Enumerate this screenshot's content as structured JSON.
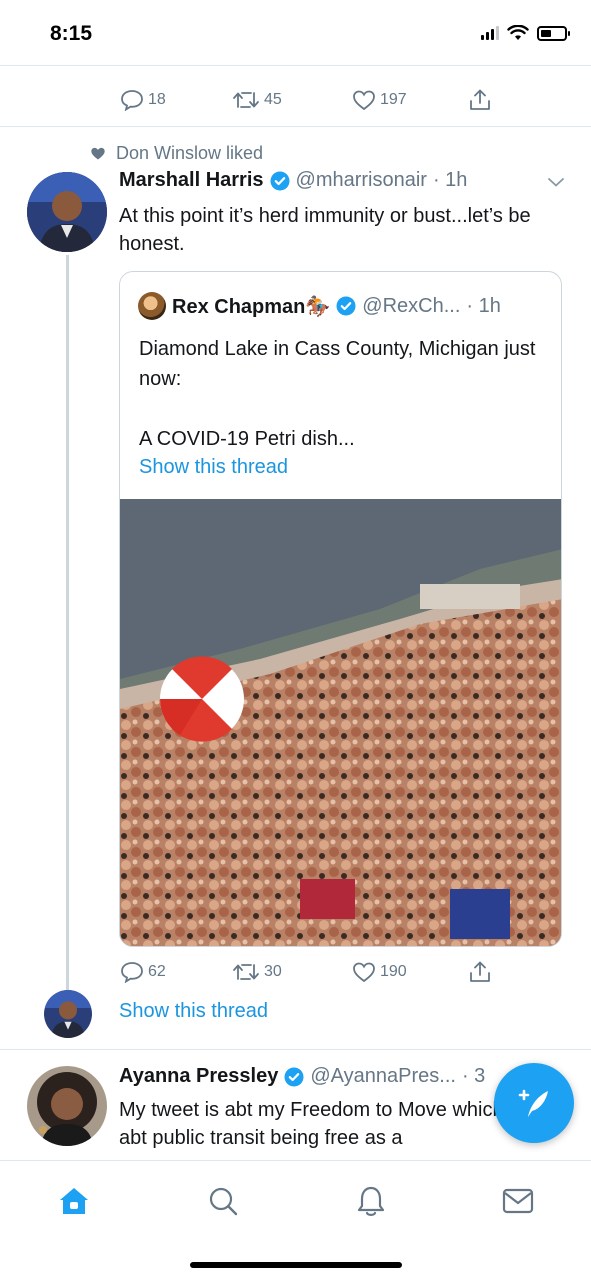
{
  "status_bar": {
    "time": "8:15",
    "battery_level": 0.45
  },
  "prev_tweet_actions": {
    "replies": "18",
    "retweets": "45",
    "likes": "197"
  },
  "tweet": {
    "liked_by": "Don Winslow liked",
    "author_name": "Marshall Harris",
    "handle": "@mharrisonair",
    "time": "· 1h",
    "text": "At this point it’s herd immunity or bust...let’s be honest.",
    "quote": {
      "author_name": "Rex Chapman🏇🏼",
      "handle": "@RexCh...",
      "time": "· 1h",
      "text": "Diamond Lake in Cass County, Michigan just now:\n\nA COVID-19 Petri dish...",
      "show_thread": "Show this thread"
    },
    "actions": {
      "replies": "62",
      "retweets": "30",
      "likes": "190"
    },
    "show_thread": "Show this thread"
  },
  "next_tweet": {
    "author_name": "Ayanna Pressley",
    "handle": "@AyannaPres...",
    "time": "· 3",
    "text": "My tweet is abt my Freedom to Move which is abt public transit being free as a"
  },
  "tab_bar": {
    "tabs": [
      {
        "name": "home",
        "icon": "home-icon",
        "active": true
      },
      {
        "name": "search",
        "icon": "search-icon",
        "active": false
      },
      {
        "name": "notifications",
        "icon": "bell-icon",
        "active": false
      },
      {
        "name": "messages",
        "icon": "mail-icon",
        "active": false
      }
    ]
  },
  "colors": {
    "accent": "#1da1f2",
    "link": "#1b95e0",
    "muted": "#657786",
    "verified": "#1da1f2"
  }
}
